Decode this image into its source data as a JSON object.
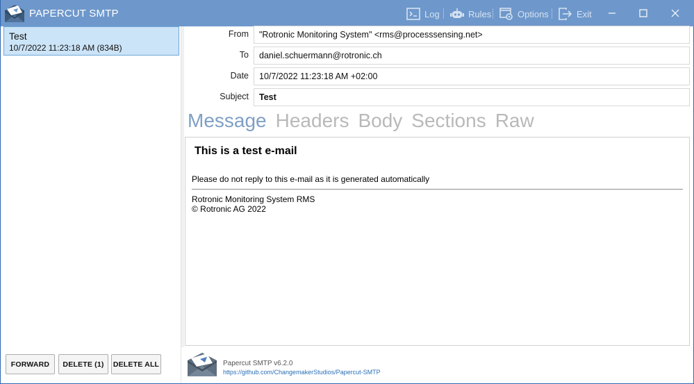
{
  "window": {
    "title": "PAPERCUT SMTP",
    "accent_color": "#6e98cb",
    "toolbar": [
      {
        "label": "Log",
        "icon": "terminal-icon"
      },
      {
        "label": "Rules",
        "icon": "robot-icon"
      },
      {
        "label": "Options",
        "icon": "settings-window-icon"
      },
      {
        "label": "Exit",
        "icon": "exit-icon"
      }
    ],
    "controls": [
      "minimize-icon",
      "maximize-icon",
      "close-icon"
    ]
  },
  "messages": [
    {
      "subject": "Test",
      "meta": "10/7/2022 11:23:18 AM (834B)",
      "selected": true
    }
  ],
  "actions": {
    "forward": "FORWARD",
    "delete": "DELETE (1)",
    "delete_all": "DELETE ALL"
  },
  "headers": {
    "from_label": "From",
    "from_value": "\"Rotronic Monitoring System\" <rms@processsensing.net>",
    "to_label": "To",
    "to_value": "daniel.schuermann@rotronic.ch",
    "date_label": "Date",
    "date_value": "10/7/2022 11:23:18 AM +02:00",
    "subject_label": "Subject",
    "subject_value": "Test"
  },
  "tabs": [
    {
      "label": "Message",
      "active": true
    },
    {
      "label": "Headers",
      "active": false
    },
    {
      "label": "Body",
      "active": false
    },
    {
      "label": "Sections",
      "active": false
    },
    {
      "label": "Raw",
      "active": false
    }
  ],
  "message_body": {
    "heading": "This is a test e-mail",
    "line": "Please do not reply to this e-mail as it is generated automatically",
    "footer_line1": "Rotronic Monitoring System RMS",
    "footer_line2": "© Rotronic AG 2022"
  },
  "footer": {
    "version": "Papercut SMTP v6.2.0",
    "link": "https://github.com/ChangemakerStudios/Papercut-SMTP"
  }
}
